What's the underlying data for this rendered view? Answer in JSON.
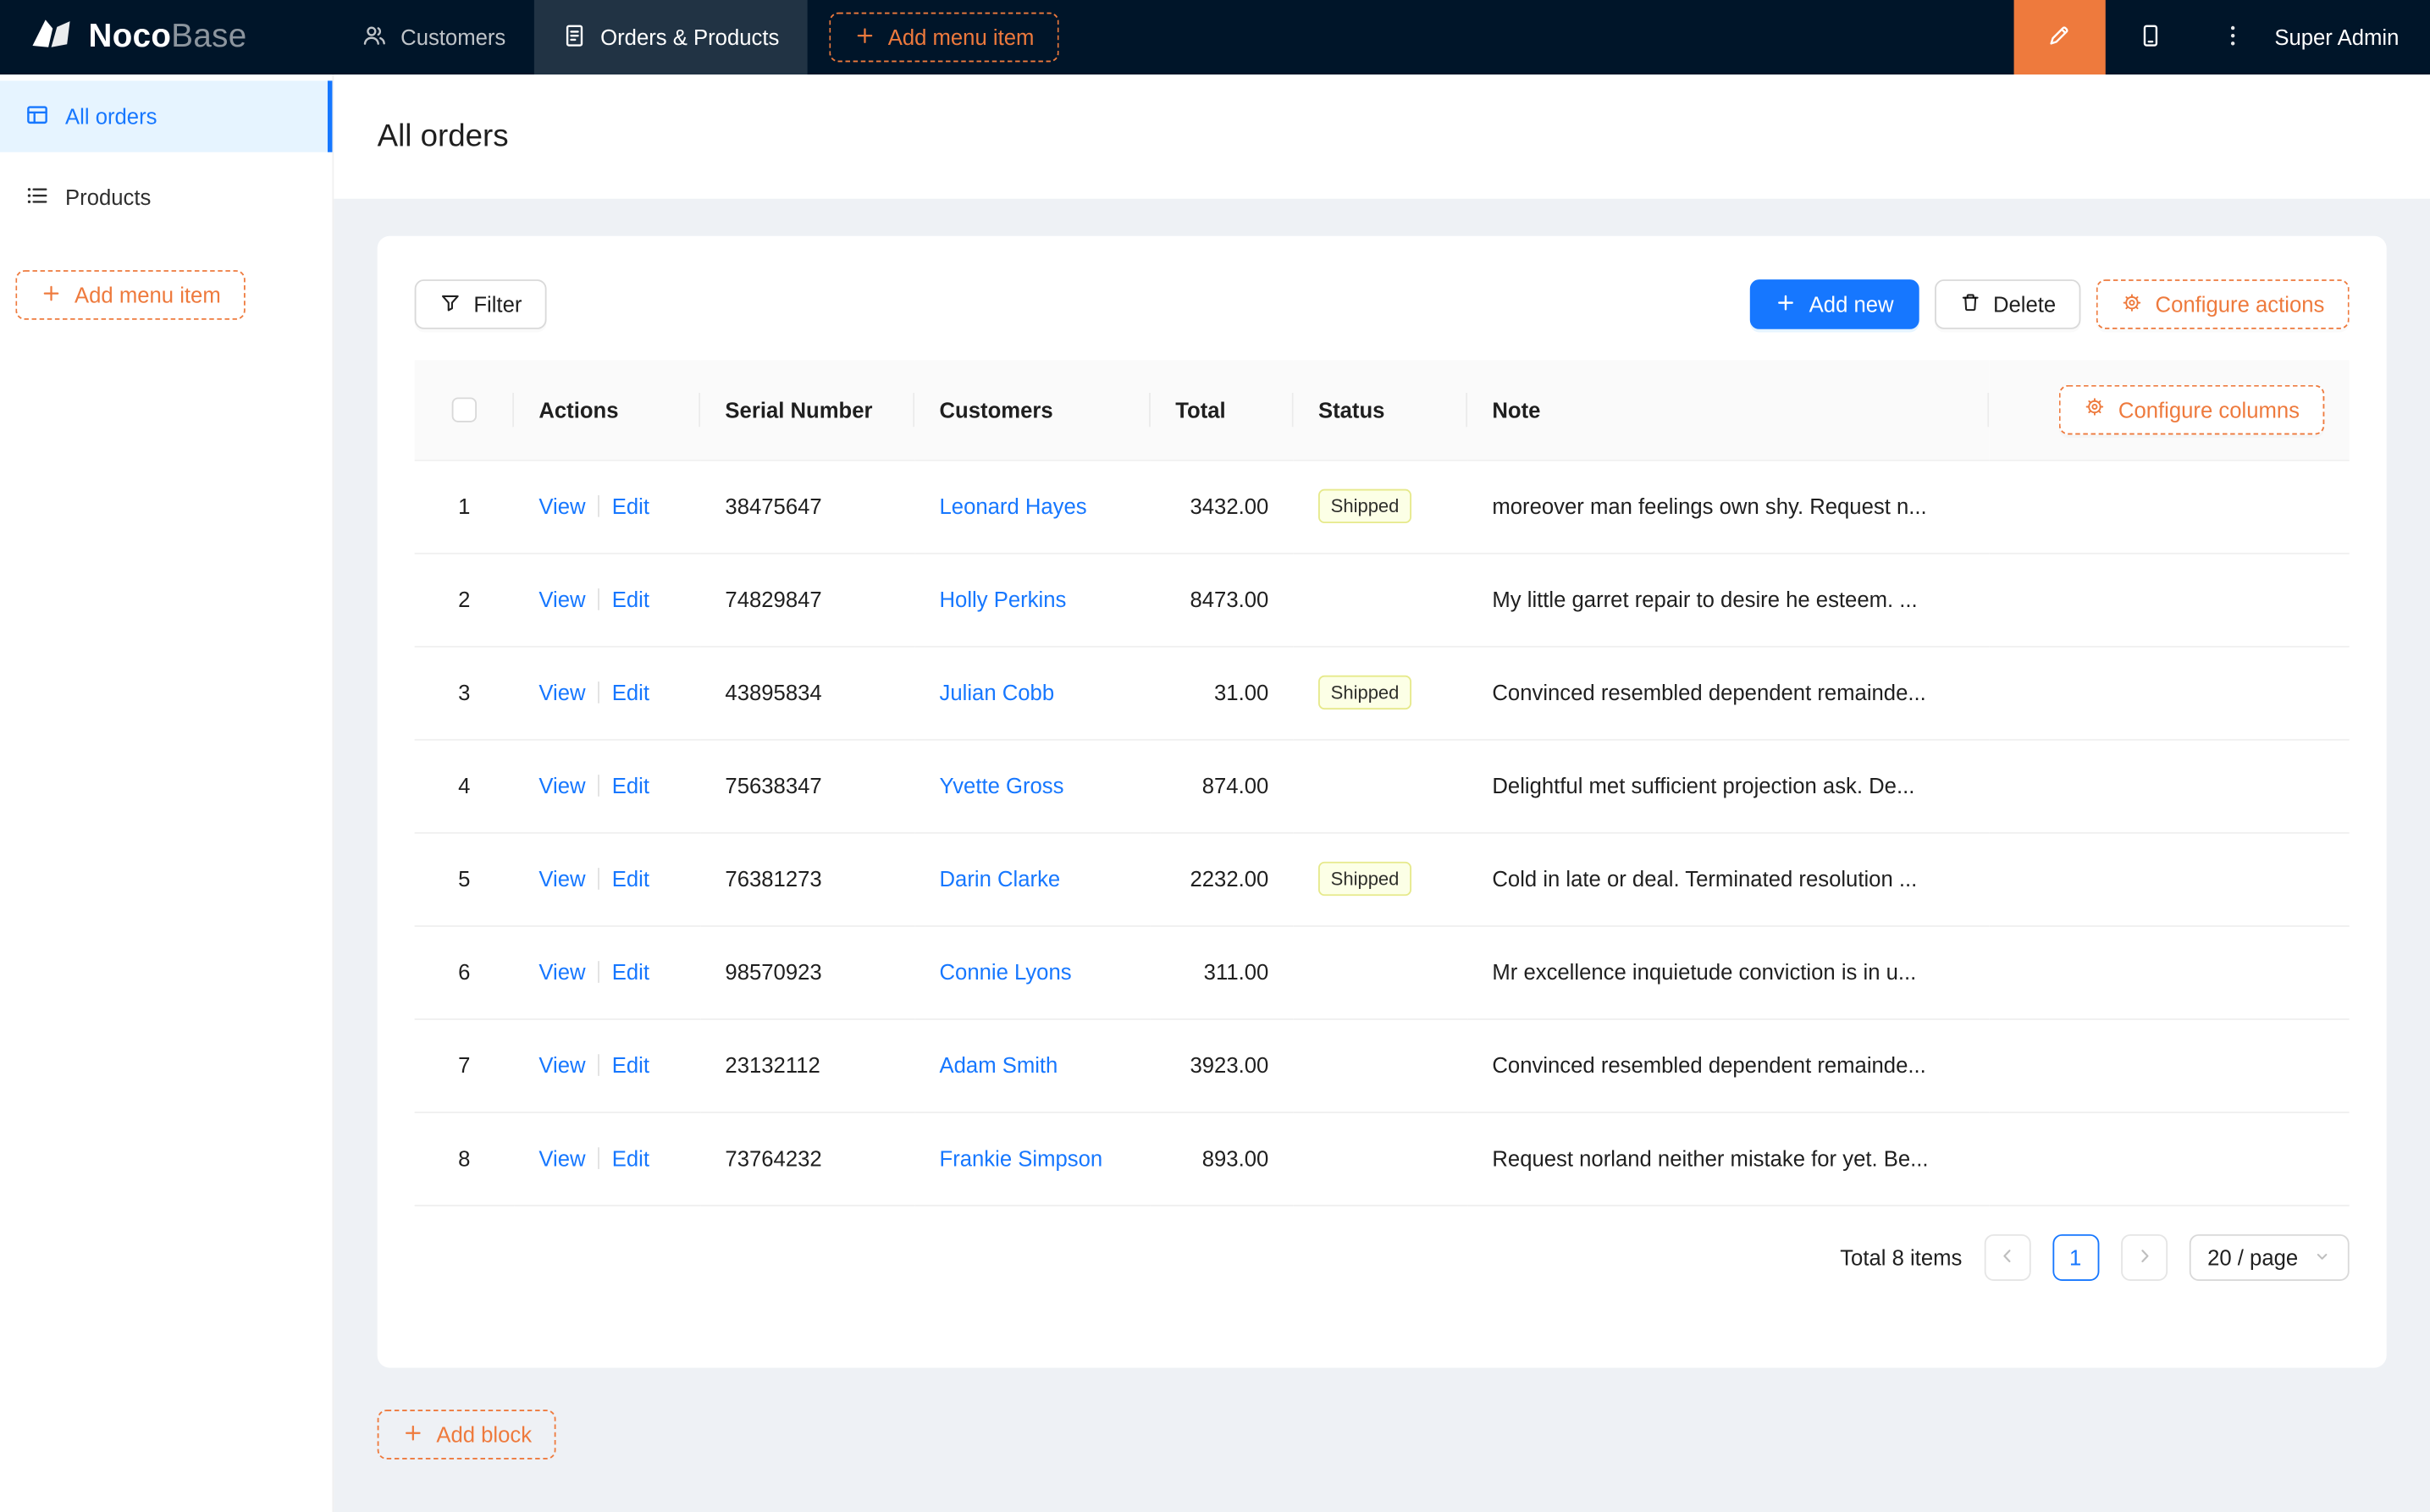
{
  "colors": {
    "accent": "#ee7a3d",
    "primary": "#1677ff",
    "tag_bg": "#fcffe6",
    "tag_border": "#e6e98b",
    "header_bg": "#001529",
    "sidebar_active_bg": "#e6f4ff"
  },
  "header": {
    "logo": {
      "bold": "Noco",
      "light": "Base"
    },
    "nav": [
      {
        "label": "Customers",
        "icon": "team-icon",
        "active": false
      },
      {
        "label": "Orders & Products",
        "icon": "file-icon",
        "active": true
      }
    ],
    "add_menu_item": "Add menu item",
    "user": "Super Admin"
  },
  "sidebar": {
    "items": [
      {
        "label": "All orders",
        "icon": "table-icon",
        "active": true
      },
      {
        "label": "Products",
        "icon": "list-icon",
        "active": false
      }
    ],
    "add_menu_item": "Add menu item"
  },
  "page": {
    "title": "All orders",
    "add_block": "Add block"
  },
  "toolbar": {
    "filter": "Filter",
    "add_new": "Add new",
    "delete": "Delete",
    "configure_actions": "Configure actions"
  },
  "table": {
    "configure_columns": "Configure columns",
    "columns": [
      "Actions",
      "Serial Number",
      "Customers",
      "Total",
      "Status",
      "Note"
    ],
    "actions": {
      "view": "View",
      "edit": "Edit"
    },
    "rows": [
      {
        "index": "1",
        "serial": "38475647",
        "customer": "Leonard Hayes",
        "total": "3432.00",
        "status": "Shipped",
        "note": "moreover man feelings own shy. Request n..."
      },
      {
        "index": "2",
        "serial": "74829847",
        "customer": "Holly Perkins",
        "total": "8473.00",
        "status": "",
        "note": "My little garret repair to desire he esteem. ..."
      },
      {
        "index": "3",
        "serial": "43895834",
        "customer": "Julian Cobb",
        "total": "31.00",
        "status": "Shipped",
        "note": "Convinced resembled dependent remainde..."
      },
      {
        "index": "4",
        "serial": "75638347",
        "customer": "Yvette Gross",
        "total": "874.00",
        "status": "",
        "note": "Delightful met sufficient projection ask. De..."
      },
      {
        "index": "5",
        "serial": "76381273",
        "customer": "Darin Clarke",
        "total": "2232.00",
        "status": "Shipped",
        "note": "Cold in late or deal. Terminated resolution ..."
      },
      {
        "index": "6",
        "serial": "98570923",
        "customer": "Connie Lyons",
        "total": "311.00",
        "status": "",
        "note": "Mr excellence inquietude conviction is in u..."
      },
      {
        "index": "7",
        "serial": "23132112",
        "customer": "Adam Smith",
        "total": "3923.00",
        "status": "",
        "note": "Convinced resembled dependent remainde..."
      },
      {
        "index": "8",
        "serial": "73764232",
        "customer": "Frankie Simpson",
        "total": "893.00",
        "status": "",
        "note": "Request norland neither mistake for yet. Be..."
      }
    ]
  },
  "pagination": {
    "total_text": "Total 8 items",
    "page": "1",
    "page_size": "20 / page"
  },
  "icons": {
    "logo": "nocobase-logo",
    "customers": "team-icon",
    "orders": "file-icon",
    "add": "plus-icon",
    "designer": "highlighter-icon",
    "mobile": "mobile-icon",
    "more": "kebab-icon",
    "all_orders": "table-icon",
    "products": "list-icon",
    "filter": "filter-icon",
    "delete": "trash-icon",
    "configure": "gear-icon",
    "prev": "chevron-left-icon",
    "next": "chevron-right-icon",
    "page_size": "chevron-down-icon"
  }
}
